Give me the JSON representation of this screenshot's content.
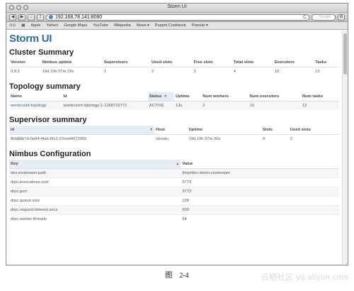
{
  "window": {
    "title": "Storm UI"
  },
  "browser": {
    "back_label": "◀",
    "forward_label": "▶",
    "url": "192.168.78.141:8080",
    "reload_label": "C",
    "search_placeholder": "Google"
  },
  "bookmarks": [
    "Apple",
    "Yahoo!",
    "Google Maps",
    "YouTube",
    "Wikipedia",
    "News ▾",
    "Puppet Cookbook",
    "Popular ▾"
  ],
  "app_title": "Storm UI",
  "cluster": {
    "heading": "Cluster Summary",
    "headers": [
      "Version",
      "Nimbus uptime",
      "Supervisors",
      "Used slots",
      "Free slots",
      "Total slots",
      "Executors",
      "Tasks"
    ],
    "rows": [
      [
        "0.8.2",
        "19d 19h 37m 29s",
        "1",
        "2",
        "2",
        "4",
        "10",
        "12"
      ]
    ]
  },
  "topology": {
    "heading": "Topology summary",
    "headers": [
      "Name",
      "Id",
      "Status",
      "Uptime",
      "Num workers",
      "Num executors",
      "Num tasks"
    ],
    "rows": [
      [
        "wordcount-topology",
        "wordcount-topology-1-1368732771",
        "ACTIVE",
        "13s",
        "2",
        "10",
        "12"
      ]
    ]
  },
  "supervisor": {
    "heading": "Supervisor summary",
    "headers": [
      "Id",
      "Host",
      "Uptime",
      "Slots",
      "Used slots"
    ],
    "rows": [
      [
        "8bb8bb7d-0e84-4fab-bfc2-22eed4072955",
        "ubuntu",
        "19d 19h 37m 26s",
        "4",
        "2"
      ]
    ]
  },
  "nimbus": {
    "heading": "Nimbus Configuration",
    "headers": [
      "Key",
      "Value"
    ],
    "rows": [
      [
        "dev.zookeeper.path",
        "/tmp/dev-storm-zookeeper"
      ],
      [
        "drpc.invocations.port",
        "3773"
      ],
      [
        "drpc.port",
        "3772"
      ],
      [
        "drpc.queue.size",
        "128"
      ],
      [
        "drpc.request.timeout.secs",
        "600"
      ],
      [
        "drpc.worker.threads",
        "64"
      ]
    ]
  },
  "caption": "图　2-4",
  "watermark": "云栖社区 yq.aliyun.com"
}
